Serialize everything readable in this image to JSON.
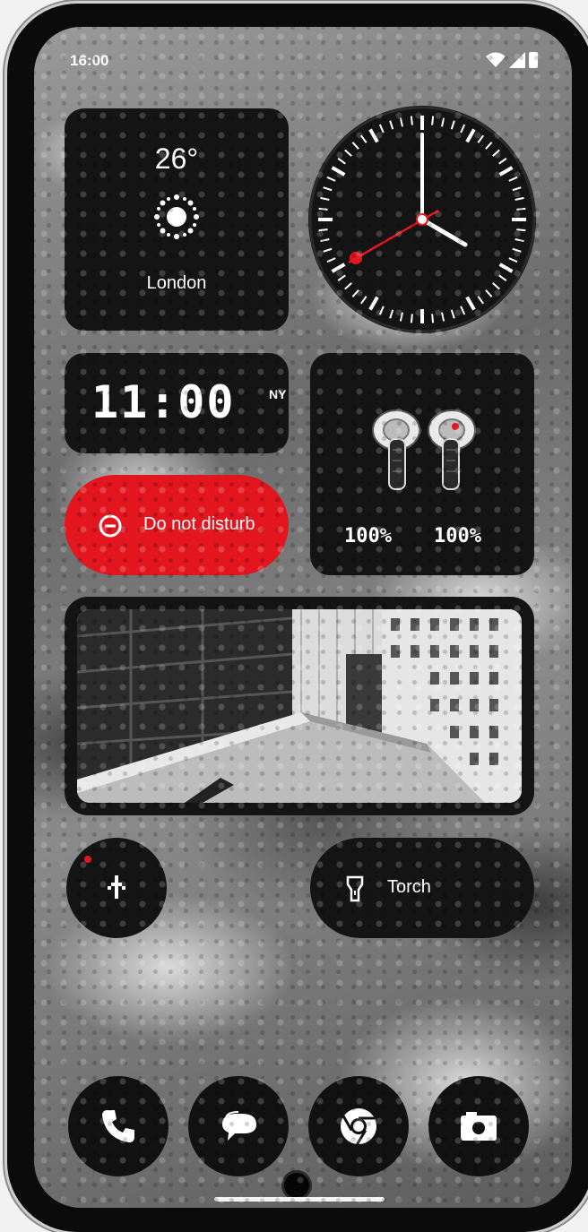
{
  "status_bar": {
    "time": "16:00",
    "icons": [
      "wifi-icon",
      "signal-icon",
      "battery-icon"
    ]
  },
  "weather_widget": {
    "temperature": "26°",
    "condition_icon": "sun-icon",
    "city": "London"
  },
  "analog_clock": {
    "hour": 4,
    "minute": 0,
    "second": 40,
    "second_hand_color": "#e3161f"
  },
  "world_clock": {
    "time": "11:00",
    "zone": "NY"
  },
  "earbuds_widget": {
    "left_battery": "100%",
    "right_battery": "100%",
    "icon": "earbuds-icon"
  },
  "dnd_tile": {
    "label": "Do not disturb",
    "icon": "minus-circle-icon",
    "color": "#e3161f"
  },
  "photo_widget": {
    "description_icon": "photo-icon"
  },
  "camera_shortcut": {
    "icon": "upload-arrow-icon",
    "badge_color": "#e3161f"
  },
  "torch_tile": {
    "label": "Torch",
    "icon": "flashlight-icon"
  },
  "dock": {
    "apps": [
      {
        "icon": "phone-icon"
      },
      {
        "icon": "messages-icon"
      },
      {
        "icon": "chrome-icon"
      },
      {
        "icon": "camera-icon"
      }
    ]
  },
  "colors": {
    "accent": "#e3161f",
    "widget_bg": "#141414"
  }
}
